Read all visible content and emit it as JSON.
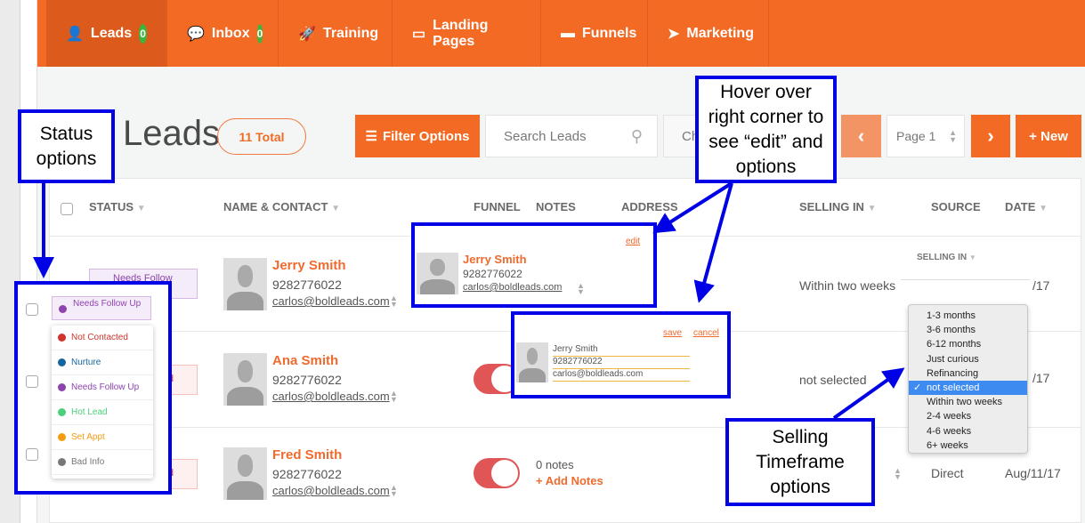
{
  "nav": {
    "tabs": [
      {
        "label": "Leads",
        "badge": "0",
        "icon": "user-icon"
      },
      {
        "label": "Inbox",
        "badge": "0",
        "icon": "chat-icon"
      },
      {
        "label": "Training",
        "icon": "rocket-icon"
      },
      {
        "label": "Landing Pages",
        "icon": "monitor-icon"
      },
      {
        "label": "Funnels",
        "icon": "comment-icon"
      },
      {
        "label": "Marketing",
        "icon": "paper-plane-icon"
      }
    ]
  },
  "page": {
    "title": "Leads",
    "total": "11 Total"
  },
  "toolbar": {
    "filter": "Filter Options",
    "search_placeholder": "Search Leads",
    "choose_partial": "Ch",
    "page": "Page 1",
    "new": "+ New"
  },
  "table": {
    "headers": {
      "status": "STATUS",
      "name": "NAME & CONTACT",
      "funnel": "FUNNEL",
      "notes": "NOTES",
      "address": "ADDRESS",
      "selling": "SELLING IN",
      "source": "SOURCE",
      "date": "DATE"
    },
    "rows": [
      {
        "status": "Needs Follow",
        "name": "Jerry Smith",
        "phone": "9282776022",
        "email": "carlos@boldleads.com",
        "selling": "Within two weeks",
        "date": "/17"
      },
      {
        "status": "d",
        "name": "Ana Smith",
        "phone": "9282776022",
        "email": "carlos@boldleads.com",
        "selling": "not selected",
        "date": "/17"
      },
      {
        "status": "d",
        "name": "Fred Smith",
        "phone": "9282776022",
        "email": "carlos@boldleads.com",
        "notes_count": "0 notes",
        "add_notes": "+ Add Notes",
        "source": "Direct",
        "date": "Aug/11/17"
      }
    ]
  },
  "status_menu": {
    "current": "Needs Follow Up",
    "options": [
      {
        "label": "Not Contacted",
        "color": "#d0342c"
      },
      {
        "label": "Nurture",
        "color": "#17659e"
      },
      {
        "label": "Needs Follow Up",
        "color": "#8e44ad"
      },
      {
        "label": "Hot Lead",
        "color": "#4ccf7d"
      },
      {
        "label": "Set Appt",
        "color": "#f39c12"
      },
      {
        "label": "Bad Info",
        "color": "#777777"
      }
    ]
  },
  "hover_card": {
    "edit": "edit",
    "name": "Jerry Smith",
    "phone": "9282776022",
    "email": "carlos@boldleads.com"
  },
  "edit_card": {
    "save": "save",
    "cancel": "cancel",
    "name": "Jerry Smith",
    "phone": "9282776022",
    "email": "carlos@boldleads.com"
  },
  "selling_dropdown": {
    "header": "SELLING IN",
    "options": [
      "1-3 months",
      "3-6 months",
      "6-12 months",
      "Just curious",
      "Refinancing",
      "not selected",
      "Within two weeks",
      "2-4 weeks",
      "4-6 weeks",
      "6+ weeks"
    ],
    "selected": "not selected"
  },
  "callouts": {
    "status": "Status options",
    "hover": "Hover over right corner to see “edit” and options",
    "selling": "Selling Timeframe options"
  },
  "colors": {
    "brand": "#f26a24",
    "annotation": "#0000e6",
    "selected": "#3d8af0"
  }
}
